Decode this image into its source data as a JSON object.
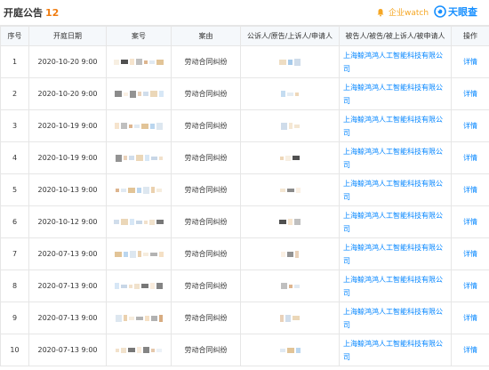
{
  "header": {
    "title": "开庭公告",
    "count": "12",
    "risk_label": "企业watch",
    "brand_name": "天眼查"
  },
  "table": {
    "columns": [
      "序号",
      "开庭日期",
      "案号",
      "案由",
      "公诉人/原告/上诉人/申请人",
      "被告人/被告/被上诉人/被申请人",
      "操作"
    ],
    "rows": [
      {
        "no": "1",
        "date": "2020-10-20 9:00",
        "cause": "劳动合同纠纷",
        "defendant": "上海鲸鸿鸿人工智能科技有限公司",
        "action": "详情"
      },
      {
        "no": "2",
        "date": "2020-10-20 9:00",
        "cause": "劳动合同纠纷",
        "defendant": "上海鲸鸿鸿人工智能科技有限公司",
        "action": "详情"
      },
      {
        "no": "3",
        "date": "2020-10-19 9:00",
        "cause": "劳动合同纠纷",
        "defendant": "上海鲸鸿鸿人工智能科技有限公司",
        "action": "详情"
      },
      {
        "no": "4",
        "date": "2020-10-19 9:00",
        "cause": "劳动合同纠纷",
        "defendant": "上海鲸鸿鸿人工智能科技有限公司",
        "action": "详情"
      },
      {
        "no": "5",
        "date": "2020-10-13 9:00",
        "cause": "劳动合同纠纷",
        "defendant": "上海鲸鸿鸿人工智能科技有限公司",
        "action": "详情"
      },
      {
        "no": "6",
        "date": "2020-10-12 9:00",
        "cause": "劳动合同纠纷",
        "defendant": "上海鲸鸿鸿人工智能科技有限公司",
        "action": "详情"
      },
      {
        "no": "7",
        "date": "2020-07-13 9:00",
        "cause": "劳动合同纠纷",
        "defendant": "上海鲸鸿鸿人工智能科技有限公司",
        "action": "详情"
      },
      {
        "no": "8",
        "date": "2020-07-13 9:00",
        "cause": "劳动合同纠纷",
        "defendant": "上海鲸鸿鸿人工智能科技有限公司",
        "action": "详情"
      },
      {
        "no": "9",
        "date": "2020-07-13 9:00",
        "cause": "劳动合同纠纷",
        "defendant": "上海鲸鸿鸿人工智能科技有限公司",
        "action": "详情"
      },
      {
        "no": "10",
        "date": "2020-07-13 9:00",
        "cause": "劳动合同纠纷",
        "defendant": "上海鲸鸿鸿人工智能科技有限公司",
        "action": "详情"
      }
    ]
  },
  "colors": {
    "accent_count": "#f07d11",
    "link": "#0084ff",
    "brand": "#1890ff",
    "risk": "#f5a623",
    "header_bg": "#f5f8fb",
    "border": "#e6e6e6"
  },
  "icons": {
    "risk": "bell-icon",
    "brand": "eye-logo-icon",
    "redaction": "pixelated-redaction"
  }
}
